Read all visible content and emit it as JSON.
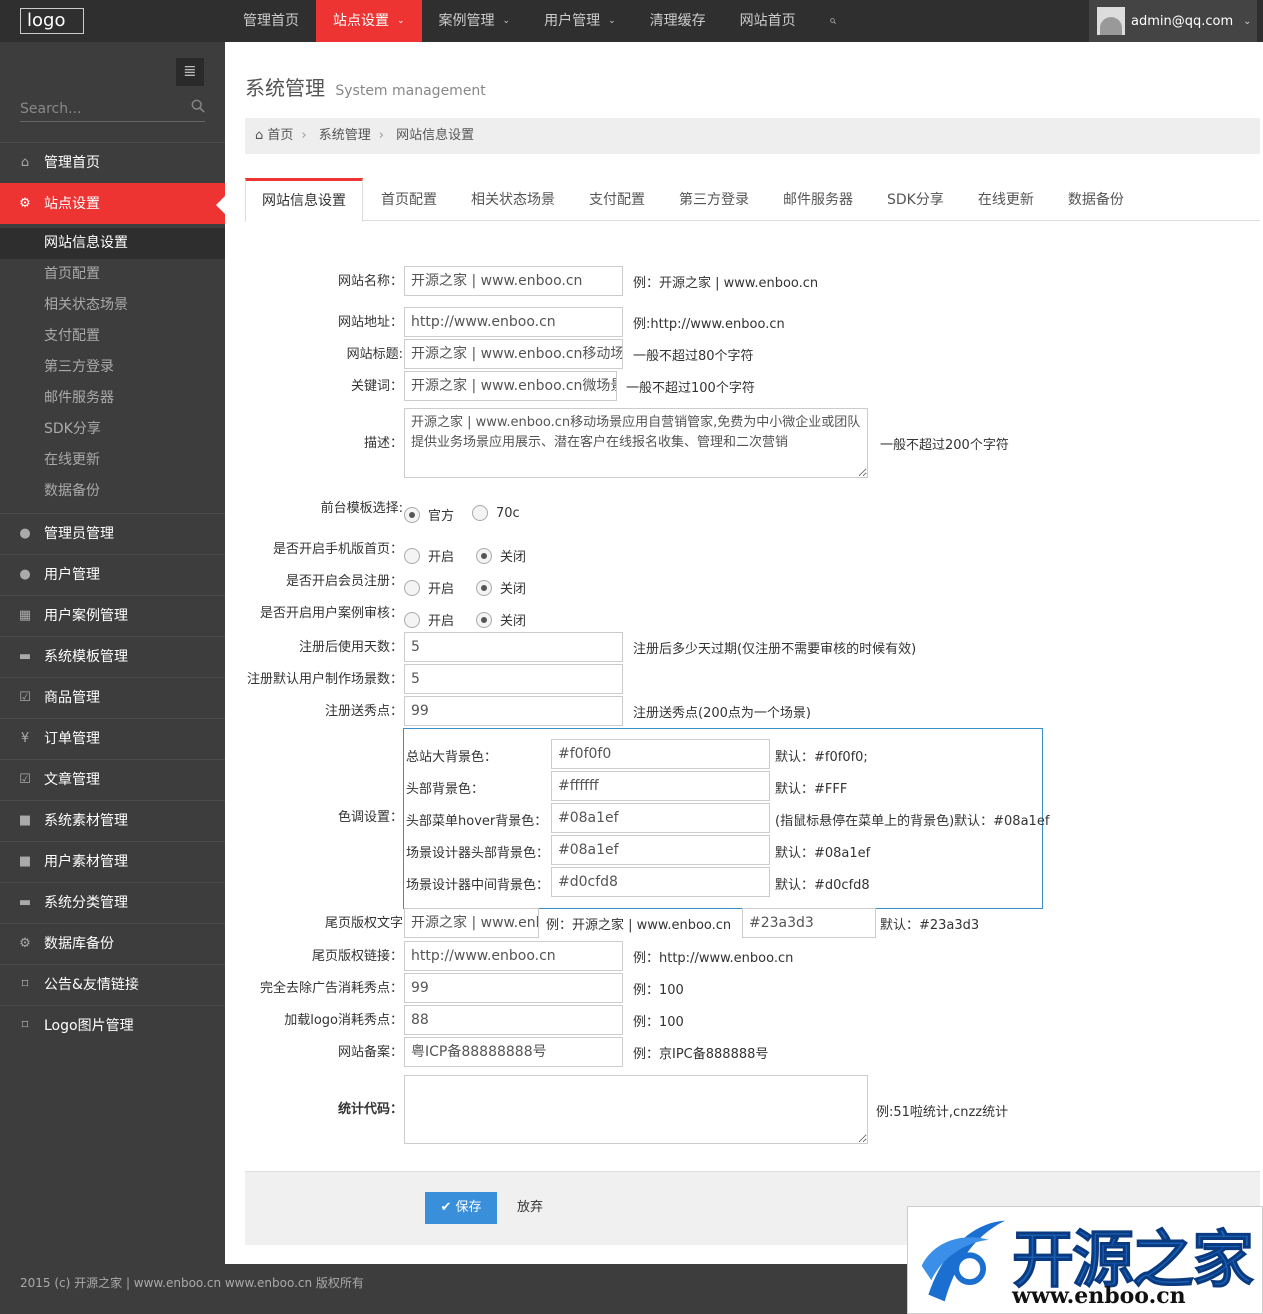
{
  "header": {
    "logo_text": "logo",
    "nav": [
      {
        "label": "管理首页",
        "dropdown": false,
        "active": false
      },
      {
        "label": "站点设置",
        "dropdown": true,
        "active": true
      },
      {
        "label": "案例管理",
        "dropdown": true,
        "active": false
      },
      {
        "label": "用户管理",
        "dropdown": true,
        "active": false
      },
      {
        "label": "清理缓存",
        "dropdown": false,
        "active": false
      },
      {
        "label": "网站首页",
        "dropdown": false,
        "active": false
      }
    ],
    "search_icon": "search-icon",
    "user_email": "admin@qq.com"
  },
  "sidebar": {
    "search_placeholder": "Search...",
    "items": [
      {
        "label": "管理首页",
        "icon": "home-icon"
      },
      {
        "label": "站点设置",
        "icon": "cogs-icon",
        "active": true
      },
      {
        "label": "管理员管理",
        "icon": "user-icon"
      },
      {
        "label": "用户管理",
        "icon": "user-icon"
      },
      {
        "label": "用户案例管理",
        "icon": "table-icon"
      },
      {
        "label": "系统模板管理",
        "icon": "briefcase-icon"
      },
      {
        "label": "商品管理",
        "icon": "check-square-icon"
      },
      {
        "label": "订单管理",
        "icon": "yen-icon"
      },
      {
        "label": "文章管理",
        "icon": "check-square-icon"
      },
      {
        "label": "系统素材管理",
        "icon": "gift-icon"
      },
      {
        "label": "用户素材管理",
        "icon": "gift-icon"
      },
      {
        "label": "系统分类管理",
        "icon": "briefcase-icon"
      },
      {
        "label": "数据库备份",
        "icon": "cogs-icon"
      },
      {
        "label": "公告&友情链接",
        "icon": "bookmark-icon"
      },
      {
        "label": "Logo图片管理",
        "icon": "bookmark-icon"
      }
    ],
    "submenu": [
      "网站信息设置",
      "首页配置",
      "相关状态场景",
      "支付配置",
      "第三方登录",
      "邮件服务器",
      "SDK分享",
      "在线更新",
      "数据备份"
    ]
  },
  "page": {
    "title": "系统管理",
    "subtitle": "System management",
    "breadcrumb": [
      "首页",
      "系统管理",
      "网站信息设置"
    ]
  },
  "tabs": [
    "网站信息设置",
    "首页配置",
    "相关状态场景",
    "支付配置",
    "第三方登录",
    "邮件服务器",
    "SDK分享",
    "在线更新",
    "数据备份"
  ],
  "form": {
    "site_name": {
      "label": "网站名称：",
      "value": "开源之家 | www.enboo.cn",
      "hint": "例：开源之家 | www.enboo.cn"
    },
    "site_url": {
      "label": "网站地址：",
      "value": "http://www.enboo.cn",
      "hint": "例:http://www.enboo.cn"
    },
    "site_title": {
      "label": "网站标题:",
      "value": "开源之家 | www.enboo.cn移动场",
      "hint": "一般不超过80个字符"
    },
    "keywords": {
      "label": "关键词：",
      "value": "开源之家 | www.enboo.cn微场景",
      "hint": "一般不超过100个字符"
    },
    "description": {
      "label": "描述：",
      "value": "开源之家 | www.enboo.cn移动场景应用自营销管家,免费为中小微企业或团队提供业务场景应用展示、潜在客户在线报名收集、管理和二次营销",
      "hint": "一般不超过200个字符"
    },
    "template": {
      "label": "前台模板选择:",
      "options": [
        "官方",
        "70c"
      ],
      "selected": "官方"
    },
    "mobile_home": {
      "label": "是否开启手机版首页：",
      "options": [
        "开启",
        "关闭"
      ],
      "selected": "关闭"
    },
    "member_register": {
      "label": "是否开启会员注册：",
      "options": [
        "开启",
        "关闭"
      ],
      "selected": "关闭"
    },
    "case_review": {
      "label": "是否开启用户案例审核：",
      "options": [
        "开启",
        "关闭"
      ],
      "selected": "关闭"
    },
    "reg_days": {
      "label": "注册后使用天数：",
      "value": "5",
      "hint": "注册后多少天过期(仅注册不需要审核的时候有效)"
    },
    "reg_scenes": {
      "label": "注册默认用户制作场景数：",
      "value": "5"
    },
    "reg_points": {
      "label": "注册送秀点：",
      "value": "99",
      "hint": "注册送秀点(200点为一个场景)"
    },
    "colors": {
      "label": "色调设置：",
      "rows": [
        {
          "label": "总站大背景色：",
          "value": "#f0f0f0",
          "hint": "默认：#f0f0f0;"
        },
        {
          "label": "头部背景色：",
          "value": "#ffffff",
          "hint": "默认：#FFF"
        },
        {
          "label": "头部菜单hover背景色：",
          "value": "#08a1ef",
          "hint": "(指鼠标悬停在菜单上的背景色)默认：#08a1ef"
        },
        {
          "label": "场景设计器头部背景色：",
          "value": "#08a1ef",
          "hint": "默认：#08a1ef"
        },
        {
          "label": "场景设计器中间背景色：",
          "value": "#d0cfd8",
          "hint": "默认：#d0cfd8"
        }
      ]
    },
    "footer_text": {
      "label": "尾页版权文字",
      "value": "开源之家 | www.enboo.cn",
      "hint": "例：开源之家 | www.enboo.cn",
      "color_value": "#23a3d3",
      "color_hint": "默认：#23a3d3"
    },
    "footer_link": {
      "label": "尾页版权链接：",
      "value": "http://www.enboo.cn",
      "hint": "例：http://www.enboo.cn"
    },
    "remove_ads": {
      "label": "完全去除广告消耗秀点：",
      "value": "99",
      "hint": "例：100"
    },
    "load_logo": {
      "label": "加载logo消耗秀点：",
      "value": "88",
      "hint": "例：100"
    },
    "icp": {
      "label": "网站备案：",
      "value": "粤ICP备88888888号",
      "hint": "例：京IPC备888888号"
    },
    "stats": {
      "label": "统计代码：",
      "value": "",
      "hint": "例:51啦统计,cnzz统计"
    }
  },
  "actions": {
    "save": "保存",
    "cancel": "放弃"
  },
  "footer": {
    "copyright": "2015 (c) 开源之家 | www.enboo.cn www.enboo.cn 版权所有"
  },
  "watermark": {
    "title": "开源之家",
    "url": "www.enboo.cn"
  },
  "colors": {
    "accent": "#ee3333",
    "primary_button": "#3a8fdb",
    "sidebar_bg": "#3d3d3d",
    "topbar_bg": "#2f2f2f"
  }
}
